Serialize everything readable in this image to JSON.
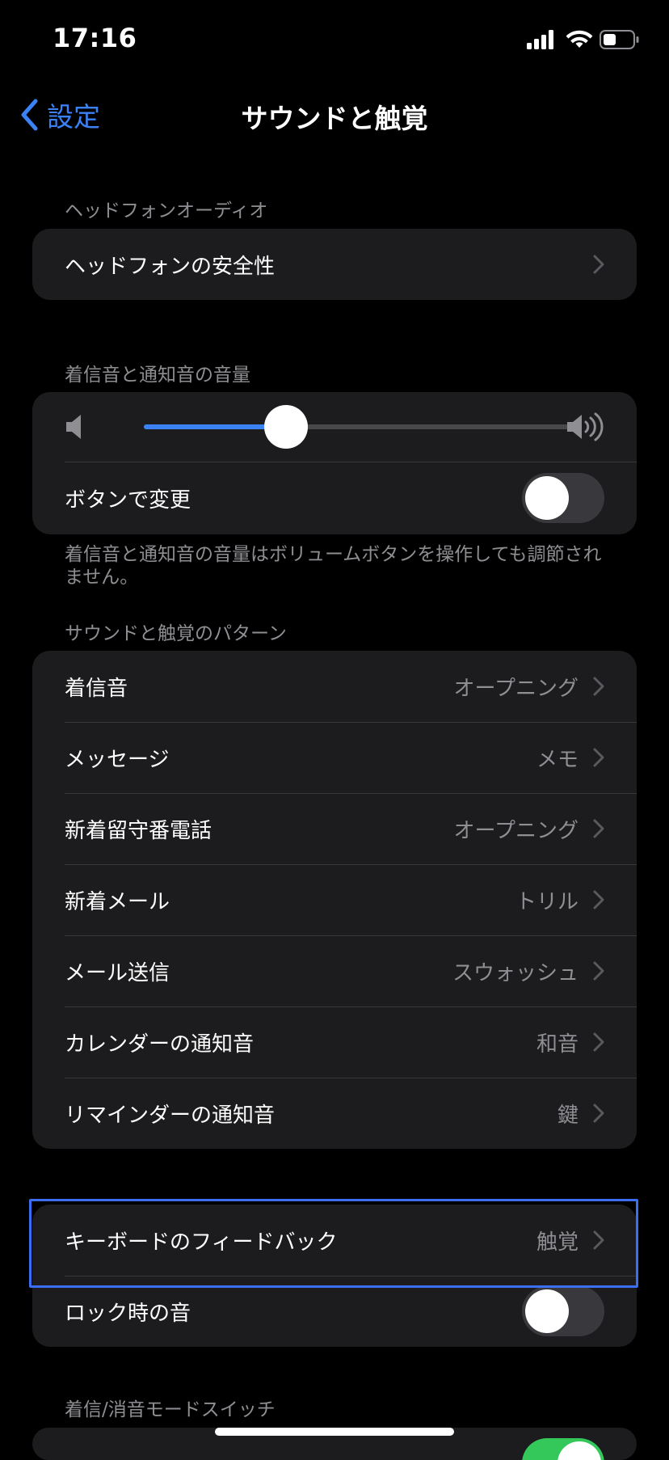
{
  "status_bar": {
    "time": "17:16"
  },
  "nav": {
    "back_label": "設定",
    "title": "サウンドと触覚"
  },
  "headphone_section": {
    "header": "ヘッドフォンオーディオ",
    "items": [
      {
        "label": "ヘッドフォンの安全性"
      }
    ]
  },
  "ringer_section": {
    "header": "着信音と通知音の音量",
    "volume_level": 0.33,
    "change_with_buttons": {
      "label": "ボタンで変更",
      "on": false
    },
    "footer": "着信音と通知音の音量はボリュームボタンを操作しても調節されません。"
  },
  "patterns_section": {
    "header": "サウンドと触覚のパターン",
    "items": [
      {
        "label": "着信音",
        "value": "オープニング"
      },
      {
        "label": "メッセージ",
        "value": "メモ"
      },
      {
        "label": "新着留守番電話",
        "value": "オープニング"
      },
      {
        "label": "新着メール",
        "value": "トリル"
      },
      {
        "label": "メール送信",
        "value": "スウォッシュ"
      },
      {
        "label": "カレンダーの通知音",
        "value": "和音"
      },
      {
        "label": "リマインダーの通知音",
        "value": "鍵"
      }
    ]
  },
  "keyboard_section": {
    "keyboard_feedback": {
      "label": "キーボードのフィードバック",
      "value": "触覚"
    },
    "lock_sound": {
      "label": "ロック時の音",
      "on": false
    }
  },
  "switch_section": {
    "header": "着信/消音モードスイッチ"
  },
  "colors": {
    "accent": "#3b82f6",
    "highlight": "#3b6ef0",
    "toggle_on": "#34c759"
  }
}
